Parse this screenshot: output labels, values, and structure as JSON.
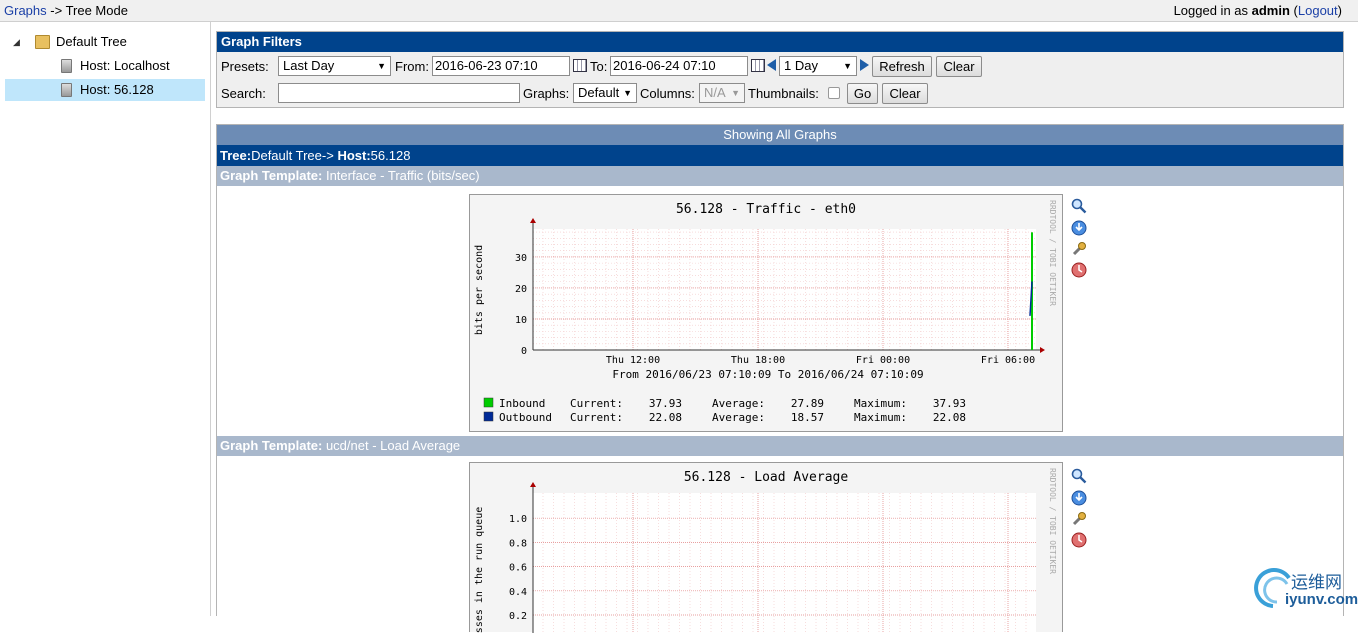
{
  "topbar": {
    "crumb_link": "Graphs",
    "crumb_sep": " -> ",
    "crumb_current": "Tree Mode",
    "login_prefix": "Logged in as ",
    "user": "admin",
    "logout": "Logout"
  },
  "tree": {
    "root": "Default Tree",
    "hosts": [
      {
        "label": "Host: Localhost",
        "selected": false
      },
      {
        "label": "Host: 56.128",
        "selected": true
      }
    ]
  },
  "filters": {
    "title": "Graph Filters",
    "presets_label": "Presets:",
    "presets_value": "Last Day",
    "from_label": "From:",
    "from_value": "2016-06-23 07:10",
    "to_label": "To:",
    "to_value": "2016-06-24 07:10",
    "span_value": "1 Day",
    "refresh": "Refresh",
    "clear": "Clear",
    "search_label": "Search:",
    "search_value": "",
    "graphs_label": "Graphs:",
    "graphs_value": "Default",
    "columns_label": "Columns:",
    "columns_value": "N/A",
    "thumbnails_label": "Thumbnails:",
    "go": "Go",
    "clear2": "Clear"
  },
  "graphs": {
    "showing": "Showing All Graphs",
    "tree_label": "Tree:",
    "tree_value": "Default Tree->",
    "host_label": " Host:",
    "host_value": "56.128",
    "templates": [
      {
        "label": "Graph Template:",
        "value": " Interface - Traffic (bits/sec)"
      },
      {
        "label": "Graph Template:",
        "value": " ucd/net - Load Average"
      }
    ]
  },
  "chart_data": [
    {
      "type": "line",
      "title": "56.128 - Traffic - eth0",
      "ylabel": "bits per second",
      "yticks": [
        0,
        10,
        20,
        30
      ],
      "xticks": [
        "Thu 12:00",
        "Thu 18:00",
        "Fri 00:00",
        "Fri 06:00"
      ],
      "subtitle": "From 2016/06/23 07:10:09 To 2016/06/24 07:10:09",
      "watermark": "RRDTOOL / TOBI OETIKER",
      "series": [
        {
          "name": "Inbound",
          "color": "#00cc00",
          "current": "37.93",
          "average": "27.89",
          "maximum": "37.93"
        },
        {
          "name": "Outbound",
          "color": "#002a97",
          "current": "22.08",
          "average": "18.57",
          "maximum": "22.08"
        }
      ],
      "legend_labels": {
        "current": "Current:",
        "average": "Average:",
        "maximum": "Maximum:"
      }
    },
    {
      "type": "line",
      "title": "56.128 - Load Average",
      "ylabel": "processes in the run queue",
      "ylabel_visible": "esses in the run queue",
      "yticks": [
        "0.2",
        "0.4",
        "0.6",
        "0.8",
        "1.0"
      ],
      "watermark": "RRDTOOL / TOBI OETIKER"
    }
  ],
  "watermark": {
    "cn": "运维网",
    "url": "iyunv.com"
  }
}
